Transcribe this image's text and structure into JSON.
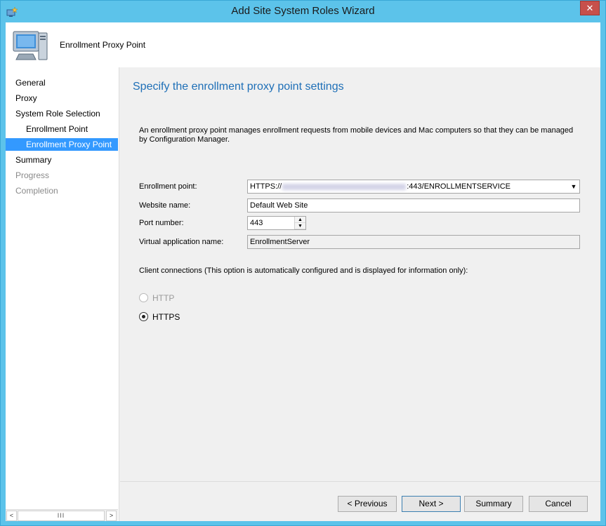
{
  "window": {
    "title": "Add Site System Roles Wizard",
    "close_glyph": "✕"
  },
  "header": {
    "title": "Enrollment Proxy Point"
  },
  "nav": {
    "items": [
      {
        "label": "General",
        "state": "normal"
      },
      {
        "label": "Proxy",
        "state": "normal"
      },
      {
        "label": "System Role Selection",
        "state": "normal"
      },
      {
        "label": "Enrollment Point",
        "state": "sub"
      },
      {
        "label": "Enrollment Proxy Point",
        "state": "selected"
      },
      {
        "label": "Summary",
        "state": "normal"
      },
      {
        "label": "Progress",
        "state": "disabled"
      },
      {
        "label": "Completion",
        "state": "disabled"
      }
    ]
  },
  "main": {
    "heading": "Specify the enrollment proxy point settings",
    "description": "An enrollment proxy point manages enrollment requests from mobile devices and Mac computers so that they can be managed by Configuration Manager.",
    "enrollment_point": {
      "label": "Enrollment point:",
      "value_prefix": "HTTPS://",
      "value_suffix": ":443/ENROLLMENTSERVICE"
    },
    "website_name": {
      "label": "Website name:",
      "value": "Default Web Site"
    },
    "port_number": {
      "label": "Port number:",
      "value": "443"
    },
    "virtual_app": {
      "label": "Virtual application name:",
      "value": "EnrollmentServer"
    },
    "client_connections_label": "Client connections (This option is automatically configured and is displayed for information only):",
    "radio_http": {
      "label": "HTTP",
      "checked": false,
      "enabled": false
    },
    "radio_https": {
      "label": "HTTPS",
      "checked": true,
      "enabled": true
    }
  },
  "footer": {
    "previous_label": "< Previous",
    "next_label": "Next >",
    "summary_label": "Summary",
    "cancel_label": "Cancel"
  },
  "colors": {
    "accent": "#3399ff",
    "heading": "#1e6fb7",
    "frame": "#5cc3ea"
  }
}
